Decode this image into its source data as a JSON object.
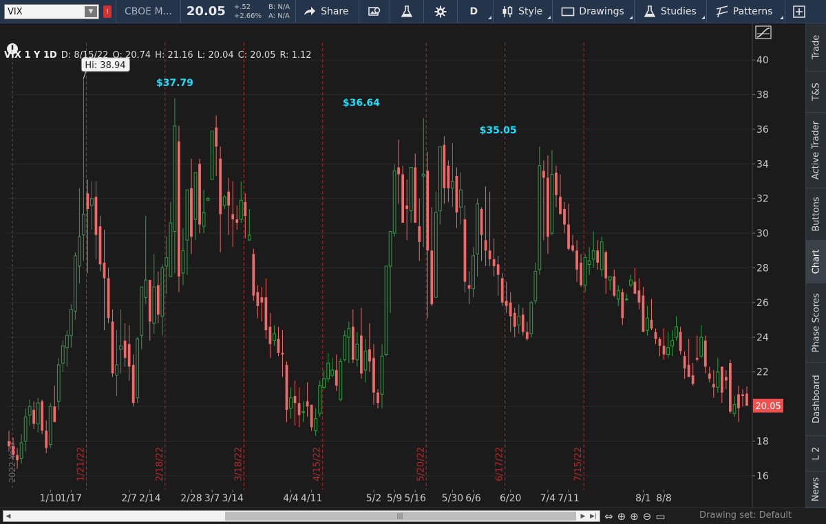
{
  "toolbar": {
    "symbol": "VIX",
    "exchange": "CBOE M...",
    "last": "20.05",
    "change": "+.52",
    "change_pct": "+2.66%",
    "bid": "B: N/A",
    "ask": "A: N/A",
    "share_label": "Share",
    "period_label": "D",
    "style_label": "Style",
    "drawings_label": "Drawings",
    "studies_label": "Studies",
    "patterns_label": "Patterns"
  },
  "chart_header": {
    "title": "VIX 1 Y 1D",
    "date": "D: 8/15/22",
    "open": "O: 20.74",
    "high": "H: 21.16",
    "low": "L: 20.04",
    "close": "C: 20.05",
    "range": "R: 1.12"
  },
  "sidebar": {
    "tabs": [
      "Trade",
      "T&S",
      "Active Trader",
      "Buttons",
      "Chart",
      "Phase Scores",
      "Dashboard",
      "L 2",
      "News"
    ]
  },
  "bottom": {
    "drawing_set": "Drawing set: Default"
  },
  "colors": {
    "up": "#2ea043",
    "down": "#f06a6a",
    "annotation": "#19e0ff",
    "price_tag": "#f05050",
    "marker_line": "#b42828"
  },
  "chart_data": {
    "type": "candlestick",
    "symbol": "VIX",
    "ylim": [
      15.2,
      41
    ],
    "y_ticks": [
      16,
      18,
      20,
      22,
      24,
      26,
      28,
      30,
      32,
      34,
      36,
      38,
      40
    ],
    "x_ticks": [
      "1/10",
      "1/17",
      "2/7",
      "2/14",
      "2/28",
      "3/7",
      "3/14",
      "4/4",
      "4/11",
      "5/2",
      "5/9",
      "5/16",
      "5/30",
      "6/6",
      "6/20",
      "7/4",
      "7/11",
      "8/1",
      "8/8"
    ],
    "x_tick_index": [
      10,
      15,
      29,
      34,
      44,
      49,
      54,
      68,
      73,
      88,
      93,
      98,
      107,
      112,
      121,
      130,
      135,
      153,
      158
    ],
    "event_markers": [
      {
        "label": "1/21/22",
        "index": 19
      },
      {
        "label": "2/18/22",
        "index": 38
      },
      {
        "label": "3/18/22",
        "index": 57
      },
      {
        "label": "4/15/22",
        "index": 76
      },
      {
        "label": "5/20/22",
        "index": 101
      },
      {
        "label": "6/17/22",
        "index": 120
      },
      {
        "label": "7/15/22",
        "index": 139
      }
    ],
    "year_marker": {
      "label": "2022 Year",
      "index": 0
    },
    "annotations": [
      {
        "text": "Hi: 38.94",
        "index": 18,
        "value": 38.94,
        "boxed": true
      },
      {
        "text": "$37.79",
        "index": 40,
        "value": 37.79
      },
      {
        "text": "$36.64",
        "index": 85,
        "value": 36.64
      },
      {
        "text": "$35.05",
        "index": 118,
        "value": 35.05
      }
    ],
    "last_price": 20.05,
    "candles": [
      [
        18.0,
        18.6,
        17.4,
        17.7
      ],
      [
        17.7,
        18.2,
        16.9,
        17.2
      ],
      [
        17.2,
        17.6,
        16.4,
        16.9
      ],
      [
        17.0,
        18.4,
        16.7,
        17.9
      ],
      [
        18.0,
        19.9,
        17.4,
        19.4
      ],
      [
        19.5,
        20.4,
        18.9,
        20.0
      ],
      [
        19.8,
        20.3,
        18.7,
        19.0
      ],
      [
        19.0,
        20.5,
        18.5,
        20.2
      ],
      [
        20.3,
        20.4,
        18.4,
        18.6
      ],
      [
        18.6,
        19.2,
        17.3,
        17.6
      ],
      [
        17.8,
        20.2,
        17.6,
        20.0
      ],
      [
        20.0,
        21.2,
        19.1,
        19.1
      ],
      [
        20.3,
        22.8,
        19.8,
        22.4
      ],
      [
        22.5,
        23.8,
        22.0,
        23.5
      ],
      [
        23.4,
        24.4,
        22.3,
        24.1
      ],
      [
        24.1,
        25.9,
        23.4,
        25.6
      ],
      [
        25.5,
        28.9,
        25.0,
        28.7
      ],
      [
        28.1,
        32.6,
        27.1,
        29.8
      ],
      [
        29.9,
        38.94,
        28.4,
        31.1
      ],
      [
        32.3,
        33.1,
        27.7,
        31.4
      ],
      [
        31.6,
        33.0,
        30.2,
        32.0
      ],
      [
        32.1,
        33.0,
        28.5,
        29.9
      ],
      [
        30.4,
        31.0,
        27.8,
        28.2
      ],
      [
        28.3,
        30.2,
        24.4,
        27.4
      ],
      [
        27.4,
        28.0,
        24.8,
        25.1
      ],
      [
        24.9,
        25.6,
        21.7,
        21.9
      ],
      [
        21.8,
        24.4,
        20.6,
        22.4
      ],
      [
        23.3,
        25.6,
        21.9,
        23.5
      ],
      [
        23.8,
        24.8,
        22.3,
        22.8
      ],
      [
        23.6,
        24.7,
        21.5,
        22.3
      ],
      [
        22.4,
        23.0,
        20.0,
        20.2
      ],
      [
        20.5,
        24.0,
        20.2,
        23.9
      ],
      [
        24.1,
        26.9,
        23.3,
        26.9
      ],
      [
        26.3,
        31.0,
        25.9,
        27.3
      ],
      [
        27.3,
        27.3,
        23.8,
        24.9
      ],
      [
        24.8,
        28.8,
        24.2,
        26.9
      ],
      [
        27.0,
        27.8,
        24.8,
        25.3
      ],
      [
        25.2,
        28.2,
        24.1,
        28.0
      ],
      [
        28.1,
        29.8,
        26.5,
        28.6
      ],
      [
        27.5,
        31.8,
        27.5,
        30.6
      ],
      [
        30.1,
        37.79,
        27.7,
        36.2
      ],
      [
        35.3,
        36.2,
        26.6,
        27.5
      ],
      [
        27.7,
        30.3,
        27.0,
        29.0
      ],
      [
        29.6,
        32.1,
        27.6,
        32.5
      ],
      [
        32.6,
        34.3,
        28.8,
        29.8
      ],
      [
        30.8,
        33.3,
        29.6,
        33.5
      ],
      [
        34.0,
        34.3,
        30.0,
        30.5
      ],
      [
        30.4,
        32.5,
        30.0,
        31.2
      ],
      [
        31.9,
        32.1,
        31.9,
        32.0
      ],
      [
        33.1,
        35.5,
        33.1,
        35.9
      ],
      [
        36.1,
        36.8,
        33.3,
        35.0
      ],
      [
        34.3,
        35.0,
        28.9,
        31.1
      ],
      [
        31.6,
        32.2,
        31.4,
        32.1
      ],
      [
        32.4,
        33.2,
        29.9,
        31.6
      ],
      [
        31.1,
        33.0,
        29.2,
        30.8
      ],
      [
        30.8,
        31.6,
        30.2,
        30.6
      ],
      [
        30.8,
        33.0,
        30.6,
        31.9
      ],
      [
        31.8,
        32.3,
        29.7,
        31.0
      ],
      [
        29.6,
        31.4,
        29.6,
        29.9
      ],
      [
        28.8,
        29.1,
        26.1,
        26.4
      ],
      [
        26.6,
        27.0,
        25.1,
        25.8
      ],
      [
        26.3,
        26.9,
        24.9,
        26.0
      ],
      [
        26.3,
        27.4,
        23.9,
        24.4
      ],
      [
        24.6,
        25.4,
        22.8,
        23.6
      ],
      [
        23.8,
        24.7,
        23.5,
        24.2
      ],
      [
        23.9,
        24.6,
        22.9,
        23.1
      ],
      [
        23.1,
        24.4,
        21.7,
        23.0
      ],
      [
        22.4,
        22.6,
        19.1,
        19.8
      ],
      [
        19.9,
        21.1,
        19.3,
        20.5
      ],
      [
        20.6,
        21.5,
        18.9,
        20.2
      ],
      [
        20.2,
        21.1,
        18.8,
        19.5
      ],
      [
        19.7,
        20.3,
        19.1,
        19.7
      ],
      [
        20.3,
        21.4,
        19.4,
        20.0
      ],
      [
        20.1,
        20.1,
        18.6,
        18.8
      ],
      [
        18.6,
        19.9,
        18.3,
        19.3
      ],
      [
        19.6,
        21.5,
        19.4,
        21.2
      ],
      [
        21.1,
        22.1,
        21.0,
        21.6
      ],
      [
        21.6,
        23.1,
        21.4,
        22.5
      ],
      [
        21.8,
        22.8,
        21.7,
        22.1
      ],
      [
        22.1,
        23.0,
        20.9,
        21.2
      ],
      [
        20.4,
        22.8,
        20.3,
        22.6
      ],
      [
        22.7,
        24.4,
        22.6,
        24.1
      ],
      [
        24.0,
        24.9,
        22.5,
        24.5
      ],
      [
        24.6,
        25.6,
        22.5,
        22.7
      ],
      [
        22.7,
        24.3,
        22.3,
        23.6
      ],
      [
        24.1,
        25.7,
        21.6,
        21.9
      ],
      [
        22.1,
        23.9,
        21.4,
        23.2
      ],
      [
        23.3,
        24.8,
        22.0,
        22.6
      ],
      [
        22.8,
        23.6,
        20.1,
        20.8
      ],
      [
        20.8,
        21.0,
        19.9,
        20.2
      ],
      [
        20.7,
        23.6,
        19.9,
        22.9
      ],
      [
        23.0,
        27.8,
        22.9,
        28.1
      ],
      [
        28.1,
        28.8,
        25.4,
        30.1
      ],
      [
        30.0,
        34.0,
        29.8,
        33.6
      ],
      [
        33.8,
        35.4,
        31.7,
        33.4
      ],
      [
        33.4,
        33.9,
        30.6,
        30.6
      ],
      [
        31.6,
        33.1,
        29.6,
        31.4
      ],
      [
        31.3,
        33.8,
        30.6,
        33.8
      ],
      [
        33.8,
        34.6,
        32.1,
        30.6
      ],
      [
        30.4,
        32.0,
        28.4,
        29.5
      ],
      [
        33.3,
        36.64,
        29.2,
        33.4
      ],
      [
        33.6,
        34.7,
        25.1,
        29.0
      ],
      [
        29.0,
        31.5,
        25.8,
        25.9
      ],
      [
        26.3,
        32.4,
        26.3,
        31.2
      ],
      [
        31.3,
        35.0,
        30.5,
        35.0
      ],
      [
        35.1,
        35.6,
        31.7,
        32.6
      ],
      [
        33.9,
        34.2,
        31.8,
        32.6
      ],
      [
        32.6,
        35.2,
        31.5,
        33.0
      ],
      [
        33.3,
        33.8,
        30.3,
        31.2
      ],
      [
        31.5,
        33.5,
        30.5,
        32.5
      ],
      [
        30.8,
        31.6,
        26.6,
        27.2
      ],
      [
        27.0,
        27.8,
        25.9,
        26.8
      ],
      [
        26.8,
        29.2,
        26.3,
        28.7
      ],
      [
        28.8,
        32.0,
        27.5,
        31.7
      ],
      [
        31.4,
        31.5,
        28.4,
        29.9
      ],
      [
        29.6,
        32.7,
        28.1,
        29.0
      ],
      [
        29.0,
        32.4,
        28.1,
        28.5
      ],
      [
        28.5,
        29.7,
        27.5,
        28.1
      ],
      [
        28.2,
        28.7,
        26.4,
        27.6
      ],
      [
        27.4,
        27.7,
        25.8,
        26.0
      ],
      [
        26.1,
        27.2,
        25.4,
        25.8
      ],
      [
        26.0,
        26.6,
        24.3,
        25.2
      ],
      [
        25.4,
        25.7,
        24.0,
        24.6
      ],
      [
        24.7,
        25.9,
        24.2,
        25.2
      ],
      [
        25.3,
        25.7,
        24.1,
        24.3
      ],
      [
        24.3,
        24.9,
        23.8,
        23.9
      ],
      [
        24.2,
        26.1,
        24.0,
        26.0
      ],
      [
        26.1,
        28.3,
        25.9,
        27.8
      ],
      [
        27.9,
        35.0,
        27.6,
        33.9
      ],
      [
        33.6,
        34.2,
        29.6,
        33.2
      ],
      [
        33.2,
        34.5,
        28.8,
        29.8
      ],
      [
        30.0,
        34.8,
        29.9,
        33.4
      ],
      [
        33.5,
        33.9,
        31.5,
        32.2
      ],
      [
        32.1,
        33.4,
        31.2,
        31.1
      ],
      [
        31.4,
        31.8,
        30.0,
        30.5
      ],
      [
        30.5,
        31.7,
        29.0,
        29.1
      ],
      [
        29.3,
        29.9,
        28.9,
        29.0
      ],
      [
        29.0,
        29.6,
        27.2,
        27.9
      ],
      [
        28.3,
        28.8,
        26.9,
        27.0
      ],
      [
        27.0,
        28.8,
        26.6,
        28.6
      ],
      [
        28.2,
        29.2,
        27.6,
        28.4
      ],
      [
        28.5,
        30.1,
        28.0,
        29.0
      ],
      [
        29.0,
        29.6,
        27.9,
        28.3
      ],
      [
        27.9,
        29.8,
        27.5,
        29.5
      ],
      [
        28.9,
        29.0,
        26.5,
        27.4
      ],
      [
        27.3,
        27.5,
        26.7,
        27.5
      ],
      [
        27.5,
        27.9,
        26.3,
        26.4
      ],
      [
        26.2,
        27.0,
        25.8,
        26.7
      ],
      [
        26.6,
        26.8,
        24.7,
        25.1
      ],
      [
        26.2,
        26.5,
        26.1,
        26.2
      ],
      [
        27.0,
        27.6,
        26.9,
        27.3
      ],
      [
        27.2,
        28.0,
        26.6,
        26.5
      ],
      [
        26.7,
        27.4,
        25.6,
        26.0
      ],
      [
        26.4,
        26.9,
        24.6,
        24.3
      ],
      [
        24.4,
        25.8,
        24.1,
        25.1
      ],
      [
        25.0,
        26.2,
        24.4,
        24.5
      ],
      [
        24.3,
        24.5,
        23.6,
        23.9
      ],
      [
        23.9,
        24.0,
        22.9,
        23.5
      ],
      [
        23.5,
        24.5,
        22.7,
        23.0
      ],
      [
        23.0,
        24.3,
        22.8,
        23.4
      ],
      [
        23.5,
        24.4,
        22.9,
        23.8
      ],
      [
        24.0,
        25.2,
        23.8,
        24.6
      ],
      [
        24.3,
        24.6,
        23.0,
        23.2
      ],
      [
        22.9,
        23.2,
        21.6,
        22.2
      ],
      [
        22.4,
        23.9,
        22.2,
        21.7
      ],
      [
        21.8,
        22.5,
        21.2,
        21.3
      ],
      [
        22.8,
        24.1,
        22.6,
        22.7
      ],
      [
        22.9,
        24.7,
        22.8,
        24.0
      ],
      [
        23.8,
        24.1,
        21.9,
        22.3
      ],
      [
        21.9,
        22.3,
        21.4,
        21.6
      ],
      [
        21.3,
        22.1,
        20.5,
        21.1
      ],
      [
        21.1,
        22.8,
        20.8,
        22.0
      ],
      [
        22.3,
        22.0,
        20.2,
        20.8
      ],
      [
        21.7,
        22.1,
        21.0,
        21.5
      ],
      [
        22.5,
        22.7,
        19.6,
        19.7
      ],
      [
        19.6,
        20.6,
        19.4,
        20.1
      ],
      [
        20.7,
        21.2,
        19.1,
        19.9
      ],
      [
        20.7,
        21.0,
        20.0,
        20.6
      ],
      [
        20.74,
        21.16,
        20.04,
        20.05
      ]
    ]
  }
}
